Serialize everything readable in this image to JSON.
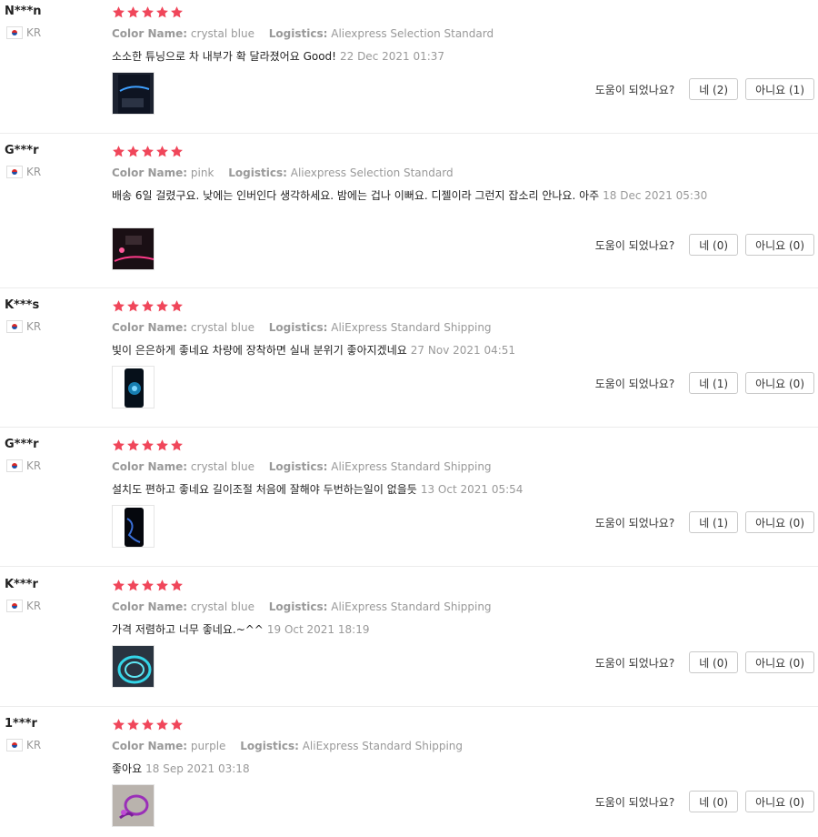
{
  "labels": {
    "color_name": "Color Name:",
    "logistics": "Logistics:",
    "helpful_question": "도움이 되었나요?",
    "yes": "네",
    "no": "아니요"
  },
  "colors": {
    "star": "#f0465a",
    "muted": "#999999"
  },
  "reviews": [
    {
      "user": "N***n",
      "country": "KR",
      "rating": 5,
      "color": "crystal blue",
      "logistics": "Aliexpress Selection Standard",
      "text": "소소한 튜닝으로 차 내부가 확 달라졌어요 Good!",
      "date": "22 Dec 2021 01:37",
      "yes": "네 (2)",
      "no": "아니요 (1)",
      "photo": "dark car interior with blue light strip"
    },
    {
      "user": "G***r",
      "country": "KR",
      "rating": 5,
      "color": "pink",
      "logistics": "Aliexpress Selection Standard",
      "text": "배송 6일 걸렸구요. 낮에는 인버인다 생각하세요. 밤에는 겁나 이뻐요. 디젤이라 그런지 잡소리 안나요. 아주",
      "date": "18 Dec 2021 05:30",
      "yes": "네 (0)",
      "no": "아니요 (0)",
      "photo": "dark car dashboard with pink light"
    },
    {
      "user": "K***s",
      "country": "KR",
      "rating": 5,
      "color": "crystal blue",
      "logistics": "AliExpress Standard Shipping",
      "text": "빛이 은은하게 좋네요 차량에 장착하면 실내 분위기 좋아지겠네요",
      "date": "27 Nov 2021 04:51",
      "yes": "네 (1)",
      "no": "아니요 (0)",
      "photo": "phone screen with blue glow"
    },
    {
      "user": "G***r",
      "country": "KR",
      "rating": 5,
      "color": "crystal blue",
      "logistics": "AliExpress Standard Shipping",
      "text": "설치도 편하고 좋네요 길이조절 처음에 잘해야 두번하는일이 없을듯",
      "date": "13 Oct 2021 05:54",
      "yes": "네 (1)",
      "no": "아니요 (0)",
      "photo": "phone screen with blue light line"
    },
    {
      "user": "K***r",
      "country": "KR",
      "rating": 5,
      "color": "crystal blue",
      "logistics": "AliExpress Standard Shipping",
      "text": "가격 저렴하고 너무 좋네요.~^^",
      "date": "19 Oct 2021 18:19",
      "yes": "네 (0)",
      "no": "아니요 (0)",
      "photo": "coiled cyan light strip"
    },
    {
      "user": "1***r",
      "country": "KR",
      "rating": 5,
      "color": "purple",
      "logistics": "AliExpress Standard Shipping",
      "text": "좋아요",
      "date": "18 Sep 2021 03:18",
      "yes": "네 (0)",
      "no": "아니요 (0)",
      "photo": "purple light strip coil"
    }
  ]
}
